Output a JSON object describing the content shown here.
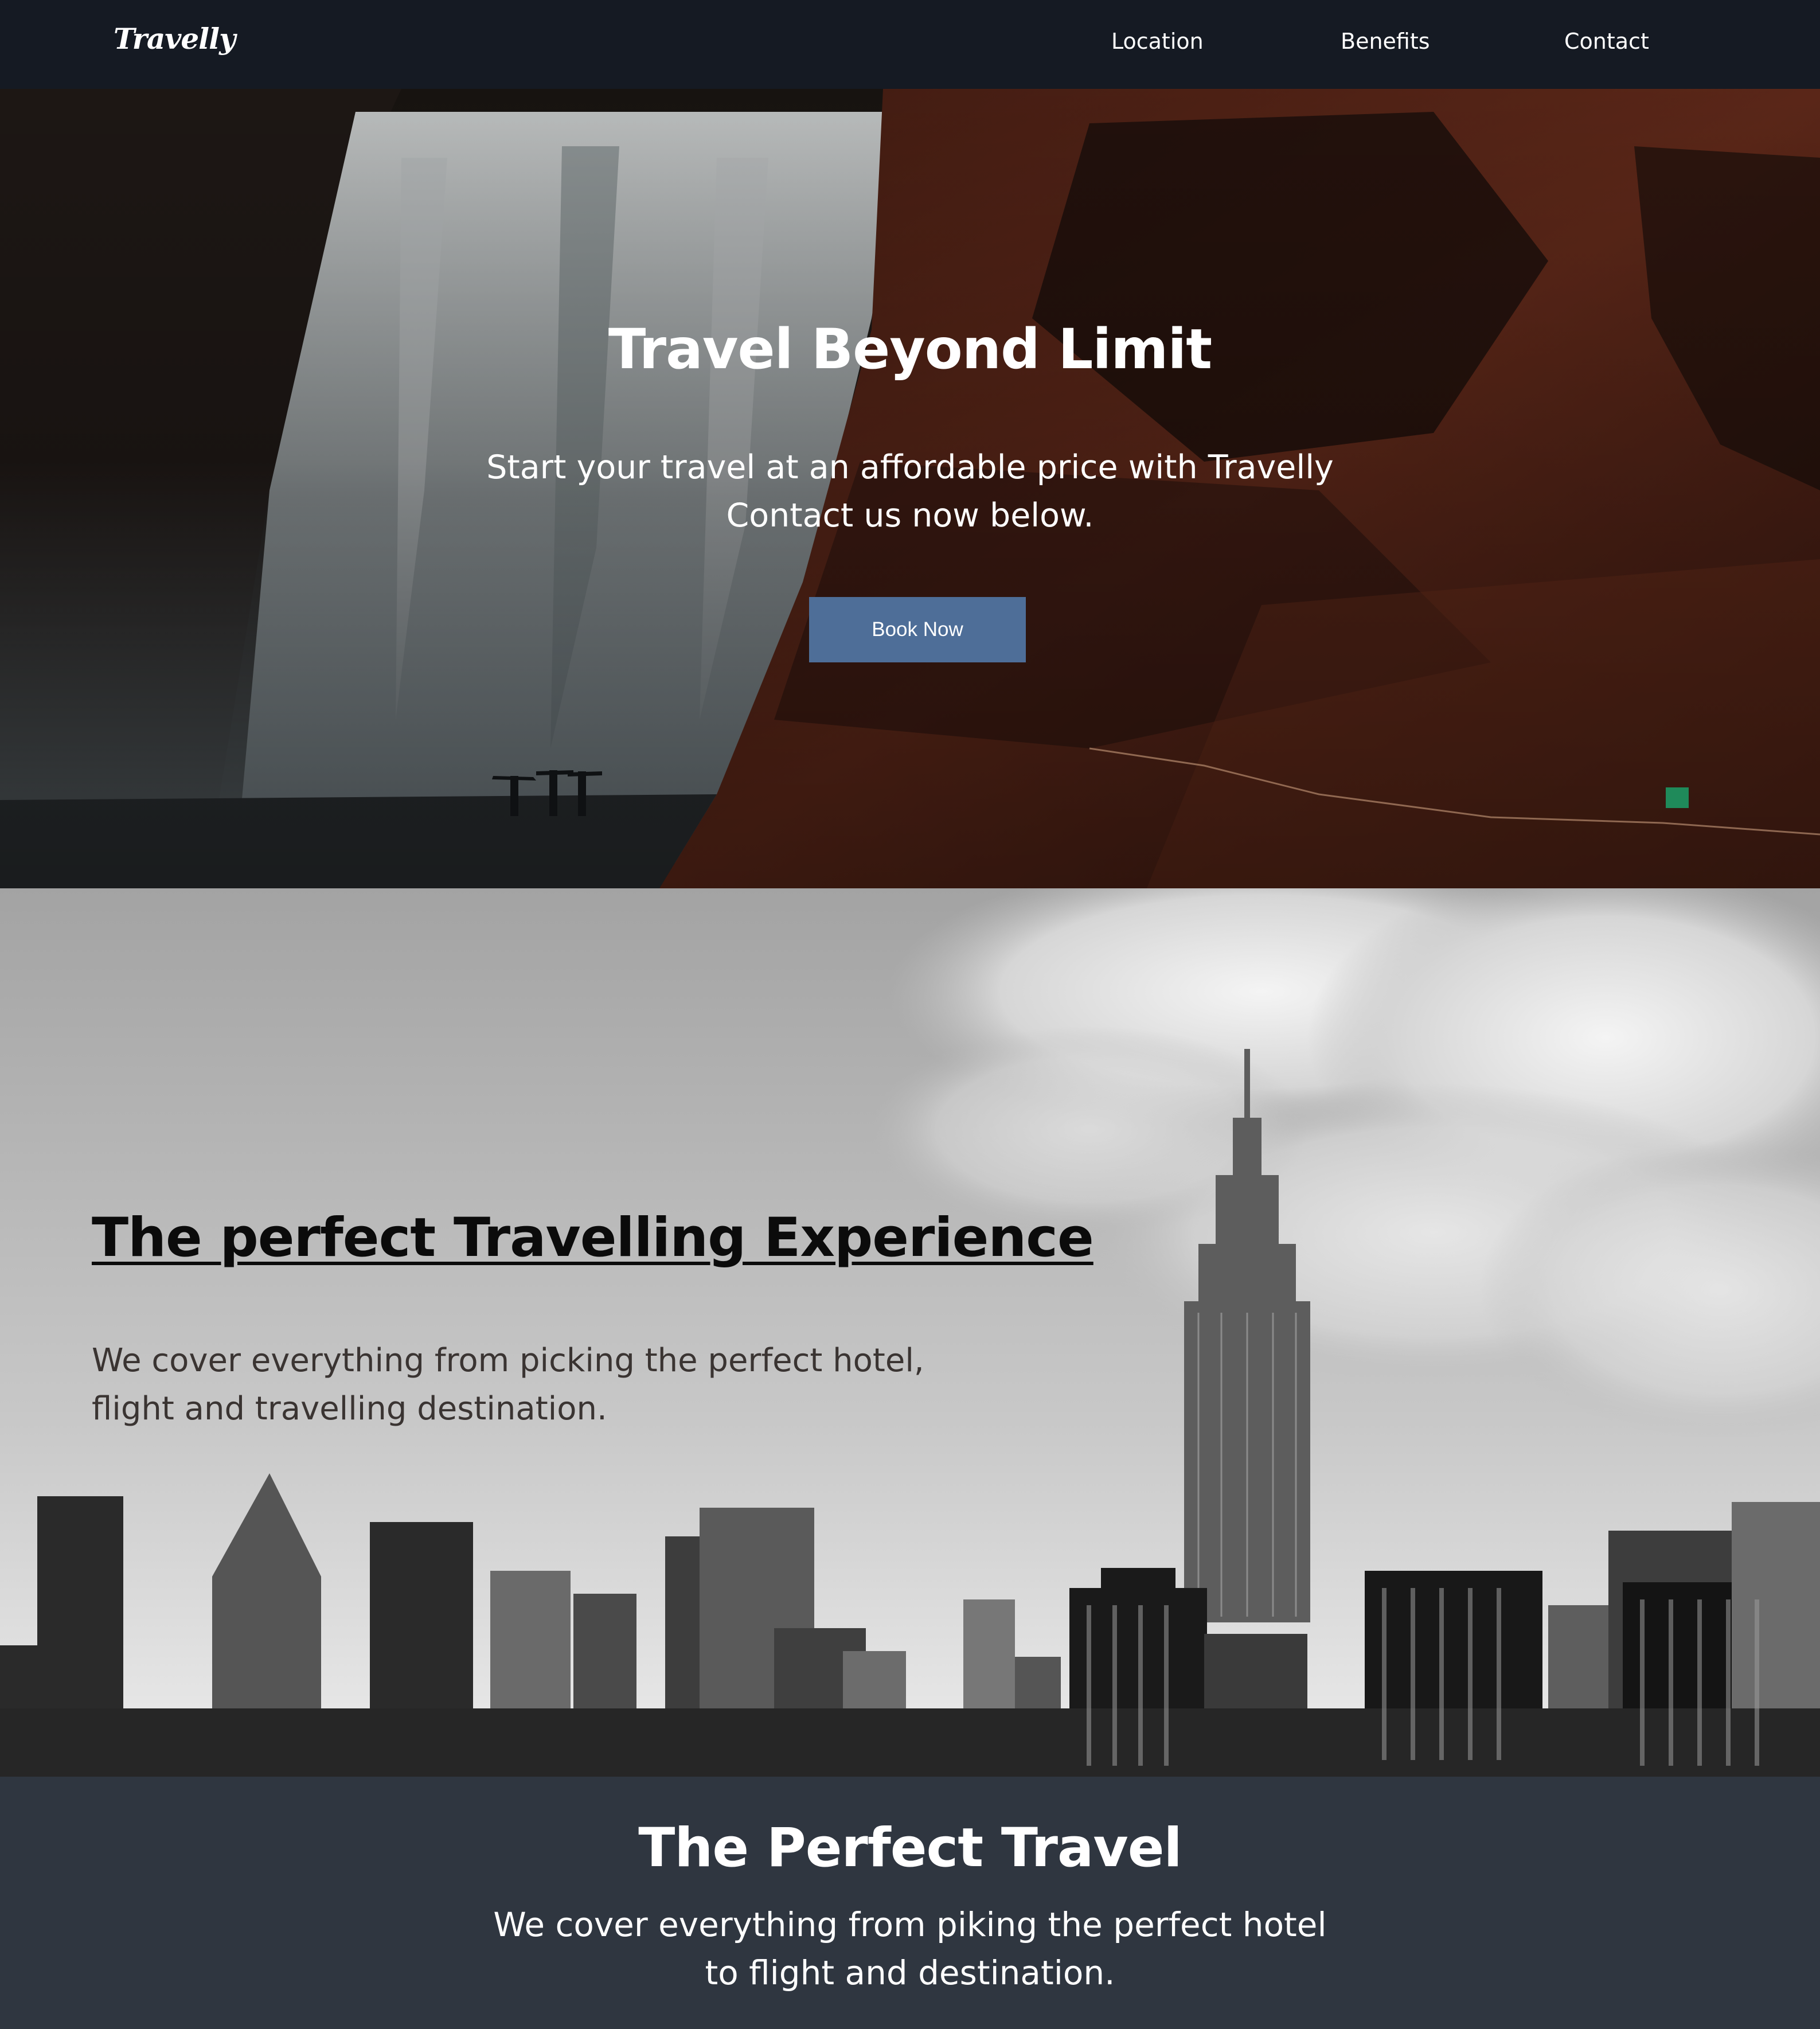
{
  "nav": {
    "logo": "Travelly",
    "links": [
      "Location",
      "Benefits",
      "Contact"
    ]
  },
  "hero": {
    "title": "Travel Beyond Limit",
    "subtitle_lines": [
      "Start your travel at an affordable price with Travelly",
      "Contact us now below."
    ],
    "button_label": "Book Now"
  },
  "experience": {
    "title": "The perfect Travelling Experience",
    "text_lines": [
      "We cover everything from picking the perfect hotel,",
      "flight and travelling destination."
    ]
  },
  "perfect_travel": {
    "title": "The Perfect Travel",
    "text_lines": [
      "We cover everything from piking the perfect hotel",
      "to flight and destination."
    ]
  },
  "colors": {
    "nav_bg": "#151a23",
    "button_bg": "#4e6e98",
    "band_bg": "#2f3640"
  }
}
